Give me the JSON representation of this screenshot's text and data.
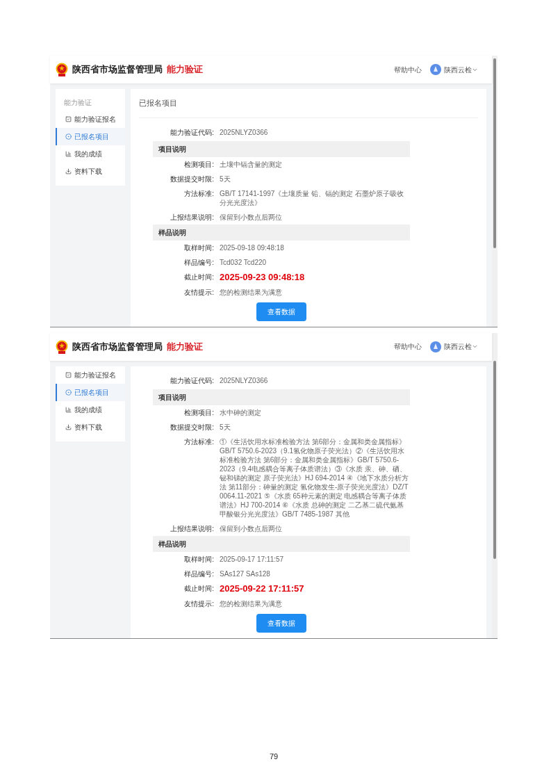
{
  "screenshots": [
    {
      "header": {
        "org": "陕西省市场监督管理局",
        "product": "能力验证",
        "help": "帮助中心",
        "user": "陕西云检"
      },
      "sidebar": {
        "heading": "能力验证",
        "items": [
          {
            "label": "能力验证报名",
            "selected": false
          },
          {
            "label": "已报名项目",
            "selected": true
          },
          {
            "label": "我的成绩",
            "selected": false
          },
          {
            "label": "资料下载",
            "selected": false
          }
        ]
      },
      "content": {
        "title": "已报名项目",
        "code_label": "能力验证代码:",
        "code": "2025NLYZ0366",
        "sections": [
          {
            "title": "项目说明",
            "fields": [
              {
                "kind": "text",
                "label": "检测项目:",
                "value": "土壤中镉含量的测定"
              },
              {
                "kind": "text",
                "label": "数据提交时限:",
                "value": "5天"
              },
              {
                "kind": "text",
                "label": "方法标准:",
                "value": "GB/T 17141-1997《土壤质量 铅、镉的测定 石墨炉原子吸收分光光度法》"
              },
              {
                "kind": "text",
                "label": "上报结果说明:",
                "value": "保留到小数点后两位"
              }
            ]
          },
          {
            "title": "样品说明",
            "fields": [
              {
                "kind": "text",
                "label": "取样时间:",
                "value": "2025-09-18 09:48:18"
              },
              {
                "kind": "text",
                "label": "样品编号:",
                "value": "Tcd032 Tcd220"
              },
              {
                "kind": "deadline",
                "label": "截止时间:",
                "value": "2025-09-23 09:48:18"
              },
              {
                "kind": "text",
                "label": "友情提示:",
                "value": "您的检测结果为满意"
              }
            ]
          }
        ],
        "button": "查看数据"
      }
    },
    {
      "header": {
        "org": "陕西省市场监督管理局",
        "product": "能力验证",
        "help": "帮助中心",
        "user": "陕西云检"
      },
      "sidebar": {
        "items": [
          {
            "label": "能力验证报名",
            "selected": false
          },
          {
            "label": "已报名项目",
            "selected": true
          },
          {
            "label": "我的成绩",
            "selected": false
          },
          {
            "label": "资料下载",
            "selected": false
          }
        ]
      },
      "content": {
        "code_label": "能力验证代码:",
        "code": "2025NLYZ0366",
        "sections": [
          {
            "title": "项目说明",
            "fields": [
              {
                "kind": "text",
                "label": "检测项目:",
                "value": "水中砷的测定"
              },
              {
                "kind": "text",
                "label": "数据提交时限:",
                "value": "5天"
              },
              {
                "kind": "text",
                "label": "方法标准:",
                "value": "①《生活饮用水标准检验方法 第6部分：金属和类金属指标》GB/T 5750.6-2023（9.1氢化物原子荧光法）②《生活饮用水标准检验方法 第6部分：金属和类金属指标》GB/T 5750.6-2023（9.4电感耦合等离子体质谱法）③《水质 汞、砷、硒、铋和锑的测定 原子荧光法》HJ 694-2014 ④《地下水质分析方法 第11部分：砷量的测定 氢化物发生-原子荧光光度法》DZ/T 0064.11-2021 ⑤《水质 65种元素的测定 电感耦合等离子体质谱法》HJ 700-2014 ⑥《水质 总砷的测定 二乙基二硫代氨基甲酸银分光光度法》GB/T 7485-1987 其他"
              },
              {
                "kind": "text",
                "label": "上报结果说明:",
                "value": "保留到小数点后两位"
              }
            ]
          },
          {
            "title": "样品说明",
            "fields": [
              {
                "kind": "text",
                "label": "取样时间:",
                "value": "2025-09-17 17:11:57"
              },
              {
                "kind": "text",
                "label": "样品编号:",
                "value": "SAs127 SAs128"
              },
              {
                "kind": "deadline",
                "label": "截止时间:",
                "value": "2025-09-22 17:11:57"
              },
              {
                "kind": "text",
                "label": "友情提示:",
                "value": "您的检测结果为满意"
              }
            ]
          }
        ],
        "button": "查看数据"
      }
    }
  ],
  "page_number": "79"
}
